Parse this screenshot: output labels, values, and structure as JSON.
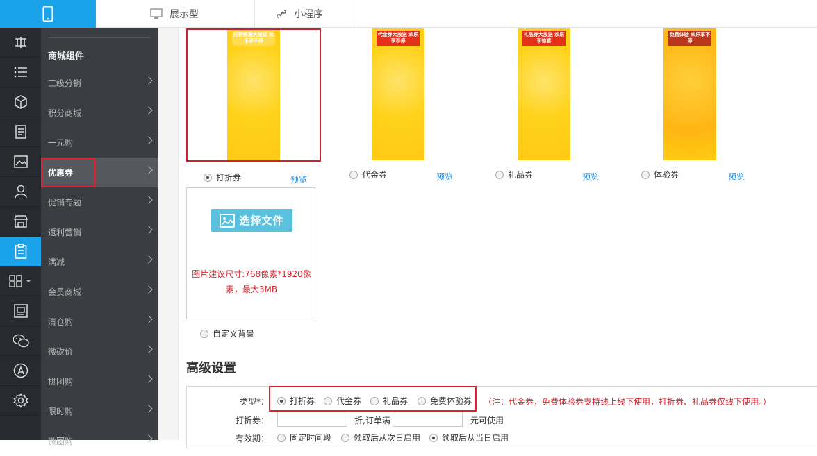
{
  "header": {
    "tabs": [
      {
        "label": "展示型",
        "icon": "monitor-icon"
      },
      {
        "label": "小程序",
        "icon": "link-icon"
      }
    ]
  },
  "rail": {
    "icons": [
      "tools-icon",
      "list-icon",
      "cube-icon",
      "document-icon",
      "image-icon",
      "user-icon",
      "store-icon",
      "clipboard-icon",
      "grid-icon",
      "picture-frame-icon",
      "wechat-icon",
      "appstore-icon",
      "settings-icon"
    ],
    "active_index": 7
  },
  "sidebar": {
    "title": "商城组件",
    "items": [
      {
        "label": "三级分销"
      },
      {
        "label": "积分商城"
      },
      {
        "label": "一元购"
      },
      {
        "label": "优惠券"
      },
      {
        "label": "促销专题"
      },
      {
        "label": "返利营销"
      },
      {
        "label": "满减"
      },
      {
        "label": "会员商城"
      },
      {
        "label": "清仓购"
      },
      {
        "label": "微砍价"
      },
      {
        "label": "拼团购"
      },
      {
        "label": "限时购"
      },
      {
        "label": "微团购"
      }
    ],
    "active_index": 3
  },
  "backgrounds": {
    "options": [
      {
        "label": "打折券",
        "preview": "预览",
        "banner": "打折优惠大放送 欢乐享不停",
        "selected": true
      },
      {
        "label": "代金券",
        "preview": "预览",
        "banner": "代金券大放送 欢乐享不停",
        "selected": false
      },
      {
        "label": "礼品券",
        "preview": "预览",
        "banner": "礼品券大放送 欢乐享惊喜",
        "selected": false
      },
      {
        "label": "体验券",
        "preview": "预览",
        "banner": "免费体验 欢乐享不停",
        "selected": false
      }
    ],
    "custom": {
      "button_label": "选择文件",
      "note": "图片建议尺寸:768像素*1920像素，最大3MB",
      "label": "自定义背景"
    }
  },
  "advanced": {
    "title": "高级设置",
    "type_label": "类型*：",
    "types": [
      {
        "label": "打折券",
        "selected": true
      },
      {
        "label": "代金券",
        "selected": false
      },
      {
        "label": "礼品券",
        "selected": false
      },
      {
        "label": "免费体验券",
        "selected": false
      }
    ],
    "type_note": "（注：代金券，免费体验券支持线上线下使用，打折券、礼品券仅线下使用。）",
    "discount_label": "打折券：",
    "discount_mid": "折,订单满",
    "discount_suffix": "元可使用",
    "validity_label": "有效期：",
    "validity_options": [
      {
        "label": "固定时间段",
        "selected": false
      },
      {
        "label": "领取后从次日启用",
        "selected": false
      },
      {
        "label": "领取后从当日启用",
        "selected": true
      }
    ]
  },
  "colors": {
    "accent": "#1aa3e8",
    "highlight": "#d9232d",
    "link": "#2d8dd6"
  }
}
